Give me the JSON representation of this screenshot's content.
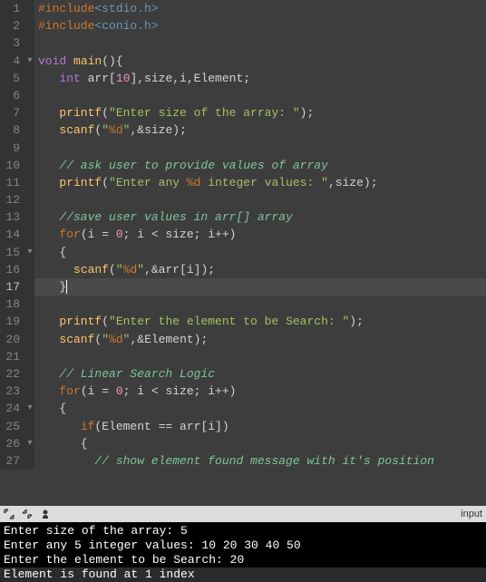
{
  "code": {
    "lines": [
      {
        "n": "1",
        "fold": "",
        "tokens": [
          {
            "t": "#include",
            "c": "preprocessor"
          },
          {
            "t": "<stdio.h>",
            "c": "preprocessor2"
          }
        ]
      },
      {
        "n": "2",
        "fold": "",
        "tokens": [
          {
            "t": "#include",
            "c": "preprocessor"
          },
          {
            "t": "<conio.h>",
            "c": "preprocessor2"
          }
        ]
      },
      {
        "n": "3",
        "fold": "",
        "tokens": []
      },
      {
        "n": "4",
        "fold": "▾",
        "tokens": [
          {
            "t": "void",
            "c": "type"
          },
          {
            "t": " ",
            "c": ""
          },
          {
            "t": "main",
            "c": "func"
          },
          {
            "t": "(){",
            "c": "bracket"
          }
        ]
      },
      {
        "n": "5",
        "fold": "",
        "tokens": [
          {
            "t": "   ",
            "c": ""
          },
          {
            "t": "int",
            "c": "type"
          },
          {
            "t": " arr[",
            "c": ""
          },
          {
            "t": "10",
            "c": "number"
          },
          {
            "t": "],size,i,Element;",
            "c": ""
          }
        ]
      },
      {
        "n": "6",
        "fold": "",
        "tokens": []
      },
      {
        "n": "7",
        "fold": "",
        "tokens": [
          {
            "t": "   ",
            "c": ""
          },
          {
            "t": "printf",
            "c": "func"
          },
          {
            "t": "(",
            "c": ""
          },
          {
            "t": "\"Enter size of the array: \"",
            "c": "string"
          },
          {
            "t": ");",
            "c": ""
          }
        ]
      },
      {
        "n": "8",
        "fold": "",
        "tokens": [
          {
            "t": "   ",
            "c": ""
          },
          {
            "t": "scanf",
            "c": "func"
          },
          {
            "t": "(",
            "c": ""
          },
          {
            "t": "\"",
            "c": "string"
          },
          {
            "t": "%d",
            "c": "format"
          },
          {
            "t": "\"",
            "c": "string"
          },
          {
            "t": ",&size);",
            "c": ""
          }
        ]
      },
      {
        "n": "9",
        "fold": "",
        "tokens": []
      },
      {
        "n": "10",
        "fold": "",
        "tokens": [
          {
            "t": "   ",
            "c": ""
          },
          {
            "t": "// ask user to provide values of array",
            "c": "comment"
          }
        ]
      },
      {
        "n": "11",
        "fold": "",
        "tokens": [
          {
            "t": "   ",
            "c": ""
          },
          {
            "t": "printf",
            "c": "func"
          },
          {
            "t": "(",
            "c": ""
          },
          {
            "t": "\"Enter any ",
            "c": "string"
          },
          {
            "t": "%d",
            "c": "format"
          },
          {
            "t": " integer values: \"",
            "c": "string"
          },
          {
            "t": ",size);",
            "c": ""
          }
        ]
      },
      {
        "n": "12",
        "fold": "",
        "tokens": []
      },
      {
        "n": "13",
        "fold": "",
        "tokens": [
          {
            "t": "   ",
            "c": ""
          },
          {
            "t": "//save user values in arr[] array",
            "c": "comment"
          }
        ]
      },
      {
        "n": "14",
        "fold": "",
        "tokens": [
          {
            "t": "   ",
            "c": ""
          },
          {
            "t": "for",
            "c": "keyword"
          },
          {
            "t": "(i = ",
            "c": ""
          },
          {
            "t": "0",
            "c": "number"
          },
          {
            "t": "; i < size; i++)",
            "c": ""
          }
        ]
      },
      {
        "n": "15",
        "fold": "▾",
        "tokens": [
          {
            "t": "   {",
            "c": ""
          }
        ]
      },
      {
        "n": "16",
        "fold": "",
        "tokens": [
          {
            "t": "     ",
            "c": ""
          },
          {
            "t": "scanf",
            "c": "func"
          },
          {
            "t": "(",
            "c": ""
          },
          {
            "t": "\"",
            "c": "string"
          },
          {
            "t": "%d",
            "c": "format"
          },
          {
            "t": "\"",
            "c": "string"
          },
          {
            "t": ",&arr[i]);",
            "c": ""
          }
        ]
      },
      {
        "n": "17",
        "fold": "",
        "highlighted": true,
        "tokens": [
          {
            "t": "   }",
            "c": ""
          },
          {
            "t": "|",
            "c": "cursor-mark"
          }
        ]
      },
      {
        "n": "18",
        "fold": "",
        "tokens": []
      },
      {
        "n": "19",
        "fold": "",
        "tokens": [
          {
            "t": "   ",
            "c": ""
          },
          {
            "t": "printf",
            "c": "func"
          },
          {
            "t": "(",
            "c": ""
          },
          {
            "t": "\"Enter the element to be Search: \"",
            "c": "string"
          },
          {
            "t": ");",
            "c": ""
          }
        ]
      },
      {
        "n": "20",
        "fold": "",
        "tokens": [
          {
            "t": "   ",
            "c": ""
          },
          {
            "t": "scanf",
            "c": "func"
          },
          {
            "t": "(",
            "c": ""
          },
          {
            "t": "\"",
            "c": "string"
          },
          {
            "t": "%d",
            "c": "format"
          },
          {
            "t": "\"",
            "c": "string"
          },
          {
            "t": ",&Element);",
            "c": ""
          }
        ]
      },
      {
        "n": "21",
        "fold": "",
        "tokens": []
      },
      {
        "n": "22",
        "fold": "",
        "tokens": [
          {
            "t": "   ",
            "c": ""
          },
          {
            "t": "// Linear Search Logic",
            "c": "comment"
          }
        ]
      },
      {
        "n": "23",
        "fold": "",
        "tokens": [
          {
            "t": "   ",
            "c": ""
          },
          {
            "t": "for",
            "c": "keyword"
          },
          {
            "t": "(i = ",
            "c": ""
          },
          {
            "t": "0",
            "c": "number"
          },
          {
            "t": "; i < size; i++)",
            "c": ""
          }
        ]
      },
      {
        "n": "24",
        "fold": "▾",
        "tokens": [
          {
            "t": "   {",
            "c": ""
          }
        ]
      },
      {
        "n": "25",
        "fold": "",
        "tokens": [
          {
            "t": "      ",
            "c": ""
          },
          {
            "t": "if",
            "c": "keyword"
          },
          {
            "t": "(Element == arr[i])",
            "c": ""
          }
        ]
      },
      {
        "n": "26",
        "fold": "▾",
        "tokens": [
          {
            "t": "      {",
            "c": ""
          }
        ]
      },
      {
        "n": "27",
        "fold": "",
        "tokens": [
          {
            "t": "        ",
            "c": ""
          },
          {
            "t": "// show element found message with it's position",
            "c": "comment"
          }
        ]
      }
    ]
  },
  "toolbar": {
    "input_label": "input"
  },
  "terminal": {
    "lines": [
      "Enter size of the array: 5",
      "Enter any 5 integer values: 10 20 30 40 50",
      "Enter the element to be Search: 20",
      "Element is found at 1 index"
    ]
  }
}
